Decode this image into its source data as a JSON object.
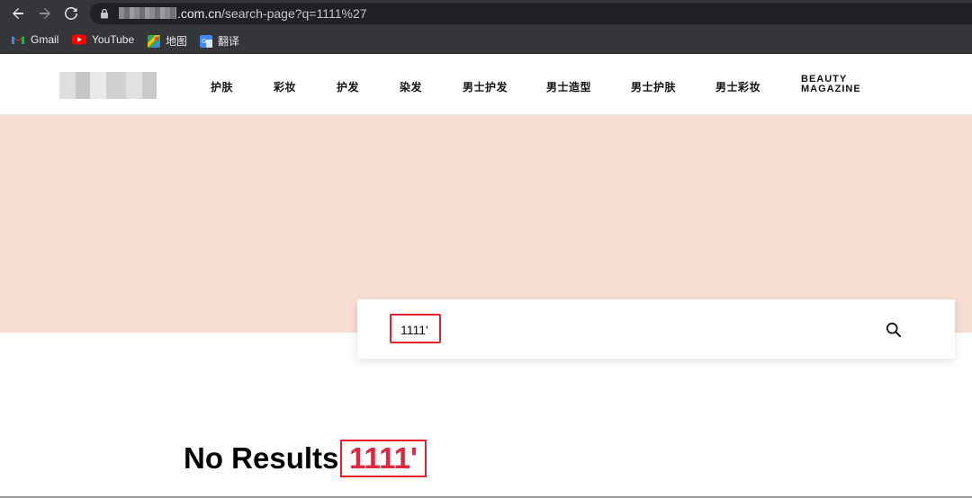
{
  "browser": {
    "url_domain": ".com.cn",
    "url_path": "/search-page?q=1111%27",
    "bookmarks": [
      {
        "label": "Gmail",
        "icon": "gmail-icon"
      },
      {
        "label": "YouTube",
        "icon": "youtube-icon"
      },
      {
        "label": "地图",
        "icon": "maps-icon"
      },
      {
        "label": "翻译",
        "icon": "translate-icon"
      }
    ]
  },
  "site": {
    "nav": [
      "护肤",
      "彩妆",
      "护发",
      "染发",
      "男士护发",
      "男士造型",
      "男士护肤",
      "男士彩妆"
    ],
    "nav_beauty": {
      "line1": "BEAUTY",
      "line2": "MAGAZINE"
    }
  },
  "search": {
    "value": "1111'"
  },
  "results": {
    "label": "No Results",
    "term": "1111'"
  },
  "colors": {
    "hero_bg": "#f7ddd2",
    "highlight_red": "#e0222c",
    "term_red": "#e3263f",
    "chrome_dark": "#35363a"
  }
}
